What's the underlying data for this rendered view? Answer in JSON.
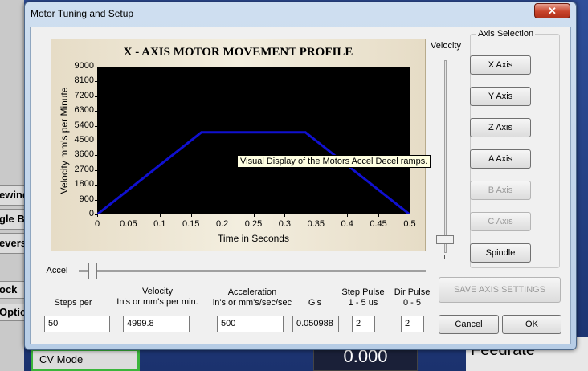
{
  "background": {
    "side_labels": [
      "ewind",
      "gle B",
      "evers",
      "ock",
      "Optio"
    ],
    "cv_mode": "CV Mode",
    "dro_value": "0.000",
    "feedrate": "Feedrate"
  },
  "dialog": {
    "title": "Motor Tuning and Setup",
    "close_glyph": "✕"
  },
  "chart_data": {
    "type": "line",
    "title": "X - AXIS MOTOR MOVEMENT PROFILE",
    "xlabel": "Time in Seconds",
    "ylabel": "Velocity mm's per Minute",
    "x_ticks": [
      "0",
      "0.05",
      "0.1",
      "0.15",
      "0.2",
      "0.25",
      "0.3",
      "0.35",
      "0.4",
      "0.45",
      "0.5"
    ],
    "y_ticks": [
      "0",
      "900",
      "1800",
      "2700",
      "3600",
      "4500",
      "5400",
      "6300",
      "7200",
      "8100",
      "9000"
    ],
    "xlim": [
      0,
      0.5
    ],
    "ylim": [
      0,
      9000
    ],
    "x": [
      0,
      0.1667,
      0.3333,
      0.5
    ],
    "y": [
      0,
      4999.8,
      4999.8,
      0
    ],
    "line_color": "#1010d0",
    "background": "#000000",
    "grid": false
  },
  "tooltip": "Visual Display of the Motors Accel  Decel ramps.",
  "velocity_slider": {
    "label": "Velocity"
  },
  "accel_slider": {
    "label": "Accel"
  },
  "axis_selection": {
    "title": "Axis Selection",
    "buttons": [
      {
        "label": "X Axis",
        "enabled": true
      },
      {
        "label": "Y Axis",
        "enabled": true
      },
      {
        "label": "Z Axis",
        "enabled": true
      },
      {
        "label": "A Axis",
        "enabled": true
      },
      {
        "label": "B Axis",
        "enabled": false
      },
      {
        "label": "C Axis",
        "enabled": false
      },
      {
        "label": "Spindle",
        "enabled": true
      }
    ]
  },
  "fields": {
    "steps_per": {
      "label": "Steps per",
      "value": "50"
    },
    "velocity": {
      "label": "Velocity\nIn's or mm's per min.",
      "value": "4999.8"
    },
    "acceleration": {
      "label": "Acceleration\nin's or mm's/sec/sec",
      "value": "500"
    },
    "gs": {
      "label": "G's",
      "value": "0.050988"
    },
    "step_pulse": {
      "label": "Step Pulse\n1 - 5 us",
      "value": "2"
    },
    "dir_pulse": {
      "label": "Dir Pulse\n0 - 5",
      "value": "2"
    }
  },
  "buttons": {
    "save": "SAVE AXIS SETTINGS",
    "cancel": "Cancel",
    "ok": "OK"
  }
}
